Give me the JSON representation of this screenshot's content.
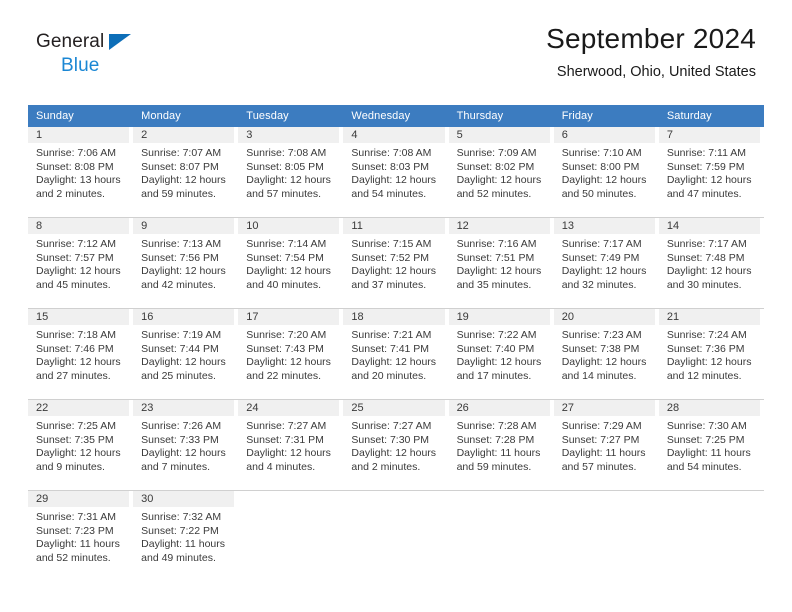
{
  "brand": {
    "name_part1": "General",
    "name_part2": "Blue",
    "triangle_color": "#0d6eb8",
    "blue_color": "#1b87d4"
  },
  "header": {
    "title": "September 2024",
    "subtitle": "Sherwood, Ohio, United States"
  },
  "theme": {
    "header_row_bg": "#3c7cc0",
    "daynum_band_bg": "#f0f0f0",
    "grid_line": "#d0d0d0",
    "text": "#3a3a3a"
  },
  "weekday_headers": [
    "Sunday",
    "Monday",
    "Tuesday",
    "Wednesday",
    "Thursday",
    "Friday",
    "Saturday"
  ],
  "labels": {
    "sunrise_prefix": "Sunrise:",
    "sunset_prefix": "Sunset:",
    "daylight_prefix": "Daylight:"
  },
  "weeks": [
    [
      {
        "day": "1",
        "sunrise": "Sunrise: 7:06 AM",
        "sunset": "Sunset: 8:08 PM",
        "daylight_line1": "Daylight: 13 hours",
        "daylight_line2": "and 2 minutes."
      },
      {
        "day": "2",
        "sunrise": "Sunrise: 7:07 AM",
        "sunset": "Sunset: 8:07 PM",
        "daylight_line1": "Daylight: 12 hours",
        "daylight_line2": "and 59 minutes."
      },
      {
        "day": "3",
        "sunrise": "Sunrise: 7:08 AM",
        "sunset": "Sunset: 8:05 PM",
        "daylight_line1": "Daylight: 12 hours",
        "daylight_line2": "and 57 minutes."
      },
      {
        "day": "4",
        "sunrise": "Sunrise: 7:08 AM",
        "sunset": "Sunset: 8:03 PM",
        "daylight_line1": "Daylight: 12 hours",
        "daylight_line2": "and 54 minutes."
      },
      {
        "day": "5",
        "sunrise": "Sunrise: 7:09 AM",
        "sunset": "Sunset: 8:02 PM",
        "daylight_line1": "Daylight: 12 hours",
        "daylight_line2": "and 52 minutes."
      },
      {
        "day": "6",
        "sunrise": "Sunrise: 7:10 AM",
        "sunset": "Sunset: 8:00 PM",
        "daylight_line1": "Daylight: 12 hours",
        "daylight_line2": "and 50 minutes."
      },
      {
        "day": "7",
        "sunrise": "Sunrise: 7:11 AM",
        "sunset": "Sunset: 7:59 PM",
        "daylight_line1": "Daylight: 12 hours",
        "daylight_line2": "and 47 minutes."
      }
    ],
    [
      {
        "day": "8",
        "sunrise": "Sunrise: 7:12 AM",
        "sunset": "Sunset: 7:57 PM",
        "daylight_line1": "Daylight: 12 hours",
        "daylight_line2": "and 45 minutes."
      },
      {
        "day": "9",
        "sunrise": "Sunrise: 7:13 AM",
        "sunset": "Sunset: 7:56 PM",
        "daylight_line1": "Daylight: 12 hours",
        "daylight_line2": "and 42 minutes."
      },
      {
        "day": "10",
        "sunrise": "Sunrise: 7:14 AM",
        "sunset": "Sunset: 7:54 PM",
        "daylight_line1": "Daylight: 12 hours",
        "daylight_line2": "and 40 minutes."
      },
      {
        "day": "11",
        "sunrise": "Sunrise: 7:15 AM",
        "sunset": "Sunset: 7:52 PM",
        "daylight_line1": "Daylight: 12 hours",
        "daylight_line2": "and 37 minutes."
      },
      {
        "day": "12",
        "sunrise": "Sunrise: 7:16 AM",
        "sunset": "Sunset: 7:51 PM",
        "daylight_line1": "Daylight: 12 hours",
        "daylight_line2": "and 35 minutes."
      },
      {
        "day": "13",
        "sunrise": "Sunrise: 7:17 AM",
        "sunset": "Sunset: 7:49 PM",
        "daylight_line1": "Daylight: 12 hours",
        "daylight_line2": "and 32 minutes."
      },
      {
        "day": "14",
        "sunrise": "Sunrise: 7:17 AM",
        "sunset": "Sunset: 7:48 PM",
        "daylight_line1": "Daylight: 12 hours",
        "daylight_line2": "and 30 minutes."
      }
    ],
    [
      {
        "day": "15",
        "sunrise": "Sunrise: 7:18 AM",
        "sunset": "Sunset: 7:46 PM",
        "daylight_line1": "Daylight: 12 hours",
        "daylight_line2": "and 27 minutes."
      },
      {
        "day": "16",
        "sunrise": "Sunrise: 7:19 AM",
        "sunset": "Sunset: 7:44 PM",
        "daylight_line1": "Daylight: 12 hours",
        "daylight_line2": "and 25 minutes."
      },
      {
        "day": "17",
        "sunrise": "Sunrise: 7:20 AM",
        "sunset": "Sunset: 7:43 PM",
        "daylight_line1": "Daylight: 12 hours",
        "daylight_line2": "and 22 minutes."
      },
      {
        "day": "18",
        "sunrise": "Sunrise: 7:21 AM",
        "sunset": "Sunset: 7:41 PM",
        "daylight_line1": "Daylight: 12 hours",
        "daylight_line2": "and 20 minutes."
      },
      {
        "day": "19",
        "sunrise": "Sunrise: 7:22 AM",
        "sunset": "Sunset: 7:40 PM",
        "daylight_line1": "Daylight: 12 hours",
        "daylight_line2": "and 17 minutes."
      },
      {
        "day": "20",
        "sunrise": "Sunrise: 7:23 AM",
        "sunset": "Sunset: 7:38 PM",
        "daylight_line1": "Daylight: 12 hours",
        "daylight_line2": "and 14 minutes."
      },
      {
        "day": "21",
        "sunrise": "Sunrise: 7:24 AM",
        "sunset": "Sunset: 7:36 PM",
        "daylight_line1": "Daylight: 12 hours",
        "daylight_line2": "and 12 minutes."
      }
    ],
    [
      {
        "day": "22",
        "sunrise": "Sunrise: 7:25 AM",
        "sunset": "Sunset: 7:35 PM",
        "daylight_line1": "Daylight: 12 hours",
        "daylight_line2": "and 9 minutes."
      },
      {
        "day": "23",
        "sunrise": "Sunrise: 7:26 AM",
        "sunset": "Sunset: 7:33 PM",
        "daylight_line1": "Daylight: 12 hours",
        "daylight_line2": "and 7 minutes."
      },
      {
        "day": "24",
        "sunrise": "Sunrise: 7:27 AM",
        "sunset": "Sunset: 7:31 PM",
        "daylight_line1": "Daylight: 12 hours",
        "daylight_line2": "and 4 minutes."
      },
      {
        "day": "25",
        "sunrise": "Sunrise: 7:27 AM",
        "sunset": "Sunset: 7:30 PM",
        "daylight_line1": "Daylight: 12 hours",
        "daylight_line2": "and 2 minutes."
      },
      {
        "day": "26",
        "sunrise": "Sunrise: 7:28 AM",
        "sunset": "Sunset: 7:28 PM",
        "daylight_line1": "Daylight: 11 hours",
        "daylight_line2": "and 59 minutes."
      },
      {
        "day": "27",
        "sunrise": "Sunrise: 7:29 AM",
        "sunset": "Sunset: 7:27 PM",
        "daylight_line1": "Daylight: 11 hours",
        "daylight_line2": "and 57 minutes."
      },
      {
        "day": "28",
        "sunrise": "Sunrise: 7:30 AM",
        "sunset": "Sunset: 7:25 PM",
        "daylight_line1": "Daylight: 11 hours",
        "daylight_line2": "and 54 minutes."
      }
    ],
    [
      {
        "day": "29",
        "sunrise": "Sunrise: 7:31 AM",
        "sunset": "Sunset: 7:23 PM",
        "daylight_line1": "Daylight: 11 hours",
        "daylight_line2": "and 52 minutes."
      },
      {
        "day": "30",
        "sunrise": "Sunrise: 7:32 AM",
        "sunset": "Sunset: 7:22 PM",
        "daylight_line1": "Daylight: 11 hours",
        "daylight_line2": "and 49 minutes."
      },
      {
        "day": "",
        "sunrise": "",
        "sunset": "",
        "daylight_line1": "",
        "daylight_line2": ""
      },
      {
        "day": "",
        "sunrise": "",
        "sunset": "",
        "daylight_line1": "",
        "daylight_line2": ""
      },
      {
        "day": "",
        "sunrise": "",
        "sunset": "",
        "daylight_line1": "",
        "daylight_line2": ""
      },
      {
        "day": "",
        "sunrise": "",
        "sunset": "",
        "daylight_line1": "",
        "daylight_line2": ""
      },
      {
        "day": "",
        "sunrise": "",
        "sunset": "",
        "daylight_line1": "",
        "daylight_line2": ""
      }
    ]
  ]
}
